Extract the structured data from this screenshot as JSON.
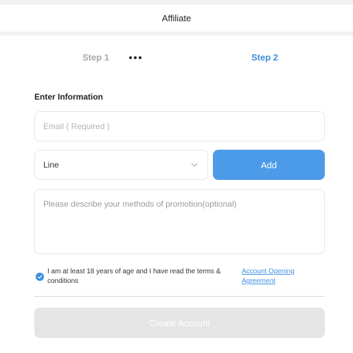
{
  "header": {
    "title": "Affiliate"
  },
  "steps": {
    "step1_label": "Step 1",
    "step2_label": "Step 2",
    "active_color": "#3e8fe0",
    "inactive_color": "#a9a9a9"
  },
  "form": {
    "section_title": "Enter Information",
    "email": {
      "value": "",
      "placeholder": "Email ( Required )"
    },
    "contact_type": {
      "selected": "Line",
      "icon": "chevron-down-icon"
    },
    "add_label": "Add",
    "description": {
      "value": "",
      "placeholder": "Please describe your methods of promotion(optional)"
    },
    "agreement": {
      "checked": true,
      "text": "I am at least 18 years of age and I have read the terms & conditions",
      "link_text": "Account Opening Agreement"
    },
    "create_label": "Create Account"
  },
  "colors": {
    "accent": "#4c9be8",
    "disabled_button": "#e5e5e5"
  }
}
